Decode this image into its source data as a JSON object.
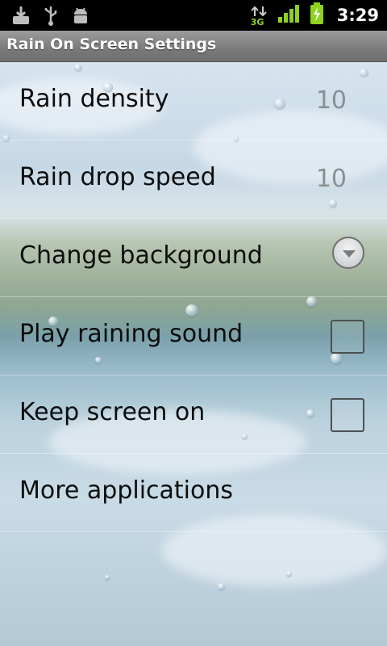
{
  "status_bar": {
    "time": "3:29",
    "network_type": "3G",
    "icons": [
      "download-icon",
      "usb-icon",
      "android-debug-icon",
      "data-arrows-icon",
      "signal-icon",
      "battery-charging-icon"
    ]
  },
  "title_bar": {
    "title": "Rain On Screen Settings"
  },
  "settings": [
    {
      "label": "Rain density",
      "value": "10",
      "control": "value"
    },
    {
      "label": "Rain drop speed",
      "value": "10",
      "control": "value"
    },
    {
      "label": "Change background",
      "control": "dropdown"
    },
    {
      "label": "Play raining sound",
      "control": "checkbox",
      "checked": false
    },
    {
      "label": "Keep screen on",
      "control": "checkbox",
      "checked": false
    },
    {
      "label": "More applications",
      "control": "none"
    }
  ],
  "colors": {
    "status_bar_bg": "#000000",
    "title_bar_bg": "#8a8a8a",
    "label_text": "#0d0d0d",
    "value_text": "#8a8f92",
    "battery_green": "#8ed21e"
  }
}
